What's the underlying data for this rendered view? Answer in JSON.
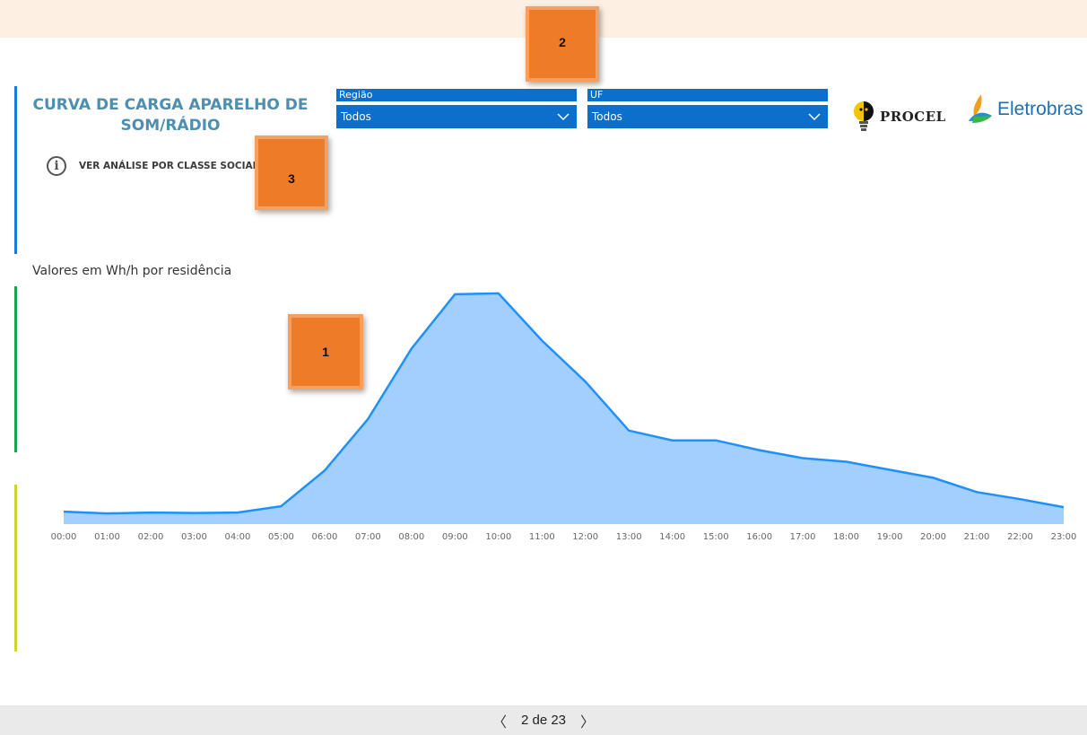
{
  "header": {
    "title": "CURVA DE CARGA APARELHO DE SOM/RÁDIO",
    "info_text": "VER ANÁLISE POR CLASSE SOCIAL"
  },
  "filters": {
    "regiao": {
      "label": "Região",
      "value": "Todos"
    },
    "uf": {
      "label": "UF",
      "value": "Todos"
    }
  },
  "logos": {
    "procel": "PROCEL",
    "eletrobras": "Eletrobras"
  },
  "markers": [
    "1",
    "2",
    "3"
  ],
  "chart_subtitle": "Valores em Wh/h por residência",
  "chart_data": {
    "type": "area",
    "title": "Valores em Wh/h por residência",
    "categories": [
      "00:00",
      "01:00",
      "02:00",
      "03:00",
      "04:00",
      "05:00",
      "06:00",
      "07:00",
      "08:00",
      "09:00",
      "10:00",
      "11:00",
      "12:00",
      "13:00",
      "14:00",
      "15:00",
      "16:00",
      "17:00",
      "18:00",
      "19:00",
      "20:00",
      "21:00",
      "22:00",
      "23:00"
    ],
    "values": [
      14,
      12,
      13,
      12.5,
      13,
      20,
      60,
      118,
      197,
      258,
      259,
      206,
      160,
      105,
      94,
      94,
      83,
      74,
      70,
      61,
      52,
      36,
      28,
      19
    ],
    "color": "#1e90ff",
    "fill": "#a3cfff",
    "ylim": [
      0,
      270
    ],
    "grid": false
  },
  "pager": {
    "text": "2 de 23",
    "prev": "〈",
    "next": "〉"
  },
  "colors": {
    "filter_bg": "#0b6fcb",
    "title": "#4c8fb1",
    "marker": "#ee7b28",
    "topbar": "#fdefe1"
  }
}
